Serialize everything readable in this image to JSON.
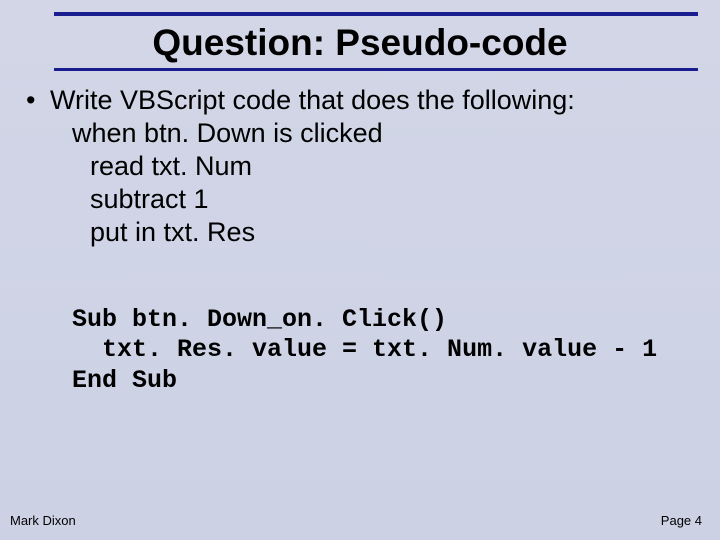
{
  "title": "Question: Pseudo-code",
  "bullet": {
    "marker": "•",
    "line": "Write VBScript code that does the following:"
  },
  "pseudo": {
    "l1": "when btn. Down is clicked",
    "l2": "read txt. Num",
    "l3": "subtract 1",
    "l4": "put in txt. Res"
  },
  "code": {
    "l1": "Sub btn. Down_on. Click()",
    "l2": "  txt. Res. value = txt. Num. value - 1",
    "l3": "End Sub"
  },
  "footer": {
    "left": "Mark Dixon",
    "right": "Page 4"
  }
}
